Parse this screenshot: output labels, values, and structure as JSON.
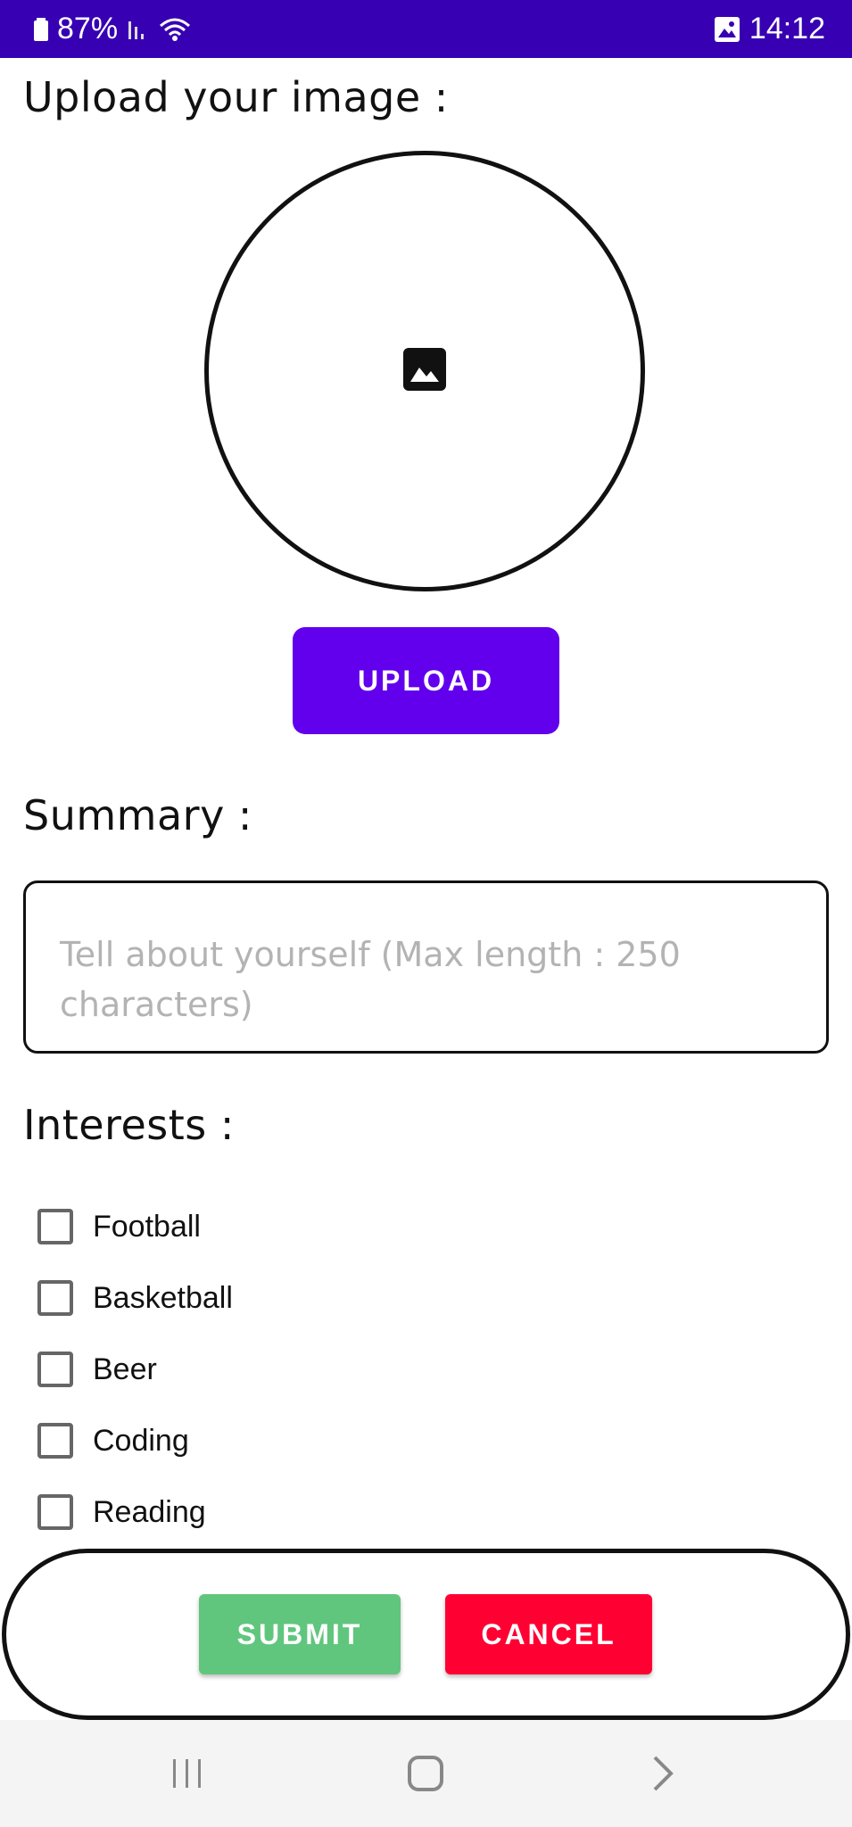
{
  "status_bar": {
    "battery": "87%",
    "time": "14:12",
    "icons": [
      "battery-icon",
      "signal-icon",
      "wifi-icon",
      "gallery-icon"
    ]
  },
  "upload_section": {
    "title": "Upload your image :",
    "image_placeholder_icon": "image-icon",
    "button_label": "UPLOAD"
  },
  "summary_section": {
    "title": "Summary :",
    "placeholder": "Tell about yourself (Max length : 250 characters)",
    "value": ""
  },
  "interests_section": {
    "title": "Interests :",
    "items": [
      {
        "label": "Football",
        "checked": false
      },
      {
        "label": "Basketball",
        "checked": false
      },
      {
        "label": "Beer",
        "checked": false
      },
      {
        "label": "Coding",
        "checked": false
      },
      {
        "label": "Reading",
        "checked": false
      }
    ]
  },
  "actions": {
    "submit_label": "SUBMIT",
    "cancel_label": "CANCEL"
  },
  "colors": {
    "status_bar": "#3700b3",
    "upload_button": "#6200ee",
    "submit_button": "#60c67d",
    "cancel_button": "#ff0033"
  },
  "nav_bar": {
    "icons": [
      "recent-apps-icon",
      "home-icon",
      "back-icon"
    ]
  }
}
